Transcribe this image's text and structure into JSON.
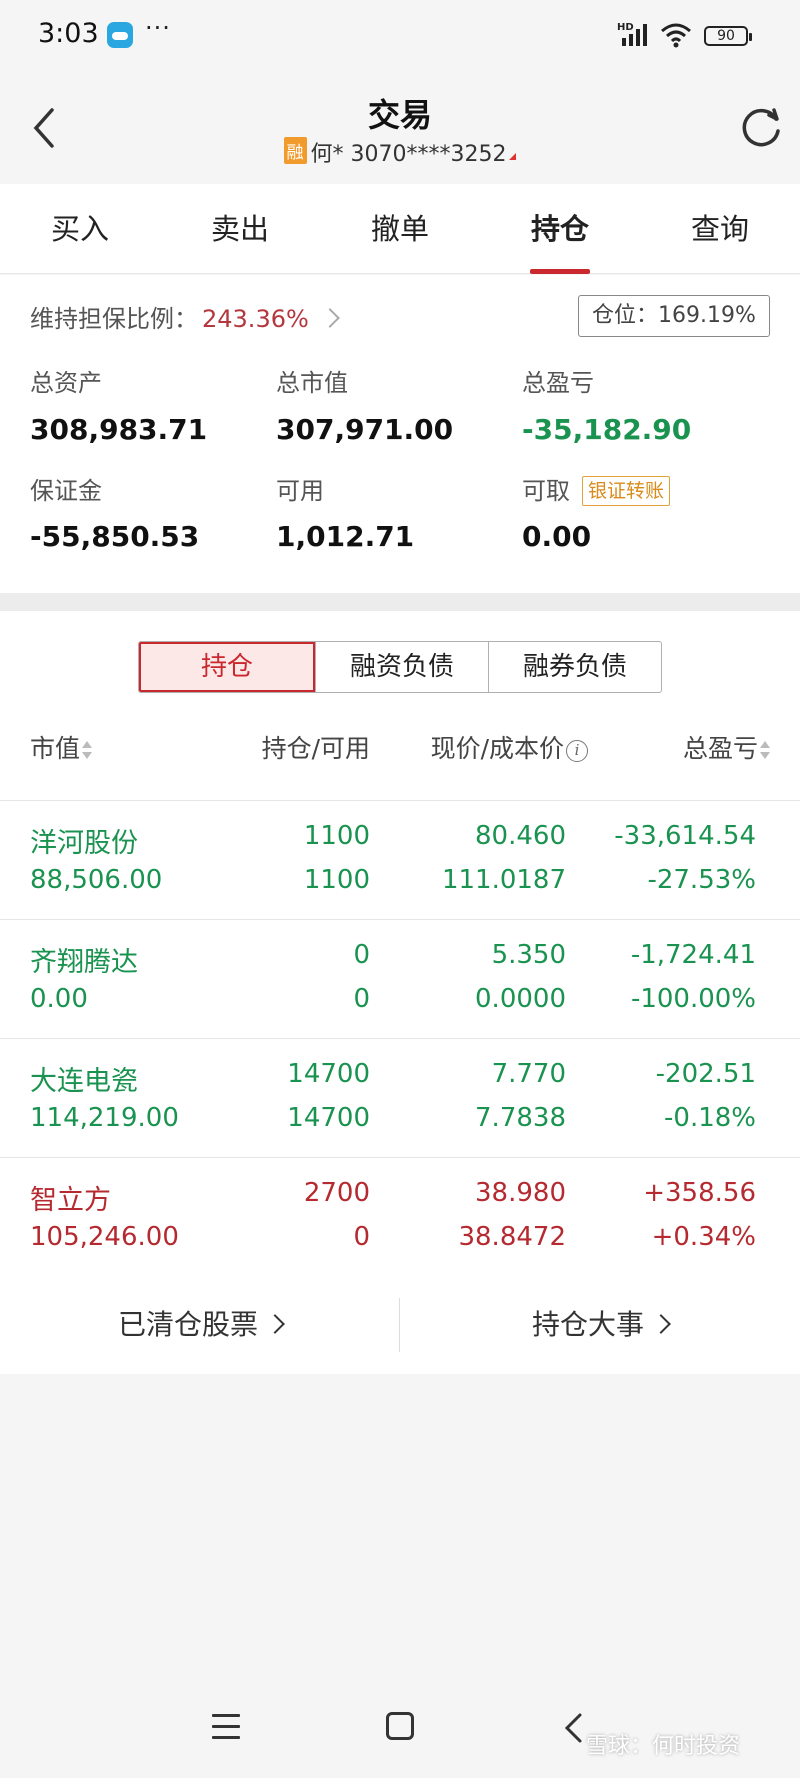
{
  "status_bar": {
    "time": "3:03",
    "dots": "···",
    "hd": "HD",
    "battery": "90"
  },
  "header": {
    "title": "交易",
    "badge": "融",
    "account": "何* 3070****3252",
    "icons": {
      "back": "chevron-left-icon",
      "refresh": "refresh-icon"
    }
  },
  "top_tabs": [
    {
      "label": "买入",
      "active": false
    },
    {
      "label": "卖出",
      "active": false
    },
    {
      "label": "撤单",
      "active": false
    },
    {
      "label": "持仓",
      "active": true
    },
    {
      "label": "查询",
      "active": false
    }
  ],
  "summary": {
    "ratio_label": "维持担保比例：",
    "ratio_value": "243.36%",
    "position_box": "仓位：169.19%",
    "total_assets_label": "总资产",
    "total_assets": "308,983.71",
    "market_value_label": "总市值",
    "market_value": "307,971.00",
    "total_pl_label": "总盈亏",
    "total_pl": "-35,182.90",
    "margin_label": "保证金",
    "margin": "-55,850.53",
    "available_label": "可用",
    "available": "1,012.71",
    "withdrawable_label": "可取",
    "withdrawable": "0.00",
    "transfer_label": "银证转账"
  },
  "segments": [
    {
      "label": "持仓",
      "active": true
    },
    {
      "label": "融资负债",
      "active": false
    },
    {
      "label": "融券负债",
      "active": false
    }
  ],
  "columns": {
    "market_value": "市值",
    "qty": "持仓/可用",
    "price": "现价/成本价",
    "info": "i",
    "pl": "总盈亏"
  },
  "holdings": [
    {
      "name": "洋河股份",
      "market_value": "88,506.00",
      "qty": "1100",
      "available": "1100",
      "price": "80.460",
      "cost": "111.0187",
      "pl": "-33,614.54",
      "pl_pct": "-27.53%",
      "tone": "green"
    },
    {
      "name": "齐翔腾达",
      "market_value": "0.00",
      "qty": "0",
      "available": "0",
      "price": "5.350",
      "cost": "0.0000",
      "pl": "-1,724.41",
      "pl_pct": "-100.00%",
      "tone": "green"
    },
    {
      "name": "大连电瓷",
      "market_value": "114,219.00",
      "qty": "14700",
      "available": "14700",
      "price": "7.770",
      "cost": "7.7838",
      "pl": "-202.51",
      "pl_pct": "-0.18%",
      "tone": "green"
    },
    {
      "name": "智立方",
      "market_value": "105,246.00",
      "qty": "2700",
      "available": "0",
      "price": "38.980",
      "cost": "38.8472",
      "pl": "+358.56",
      "pl_pct": "+0.34%",
      "tone": "red"
    }
  ],
  "links": {
    "cleared": "已清仓股票",
    "events": "持仓大事"
  },
  "watermark": "雪球：何时投资",
  "colors": {
    "accent": "#c8282e",
    "loss": "#1a9350",
    "gain": "#b52a30",
    "badge": "#f19b2c"
  }
}
